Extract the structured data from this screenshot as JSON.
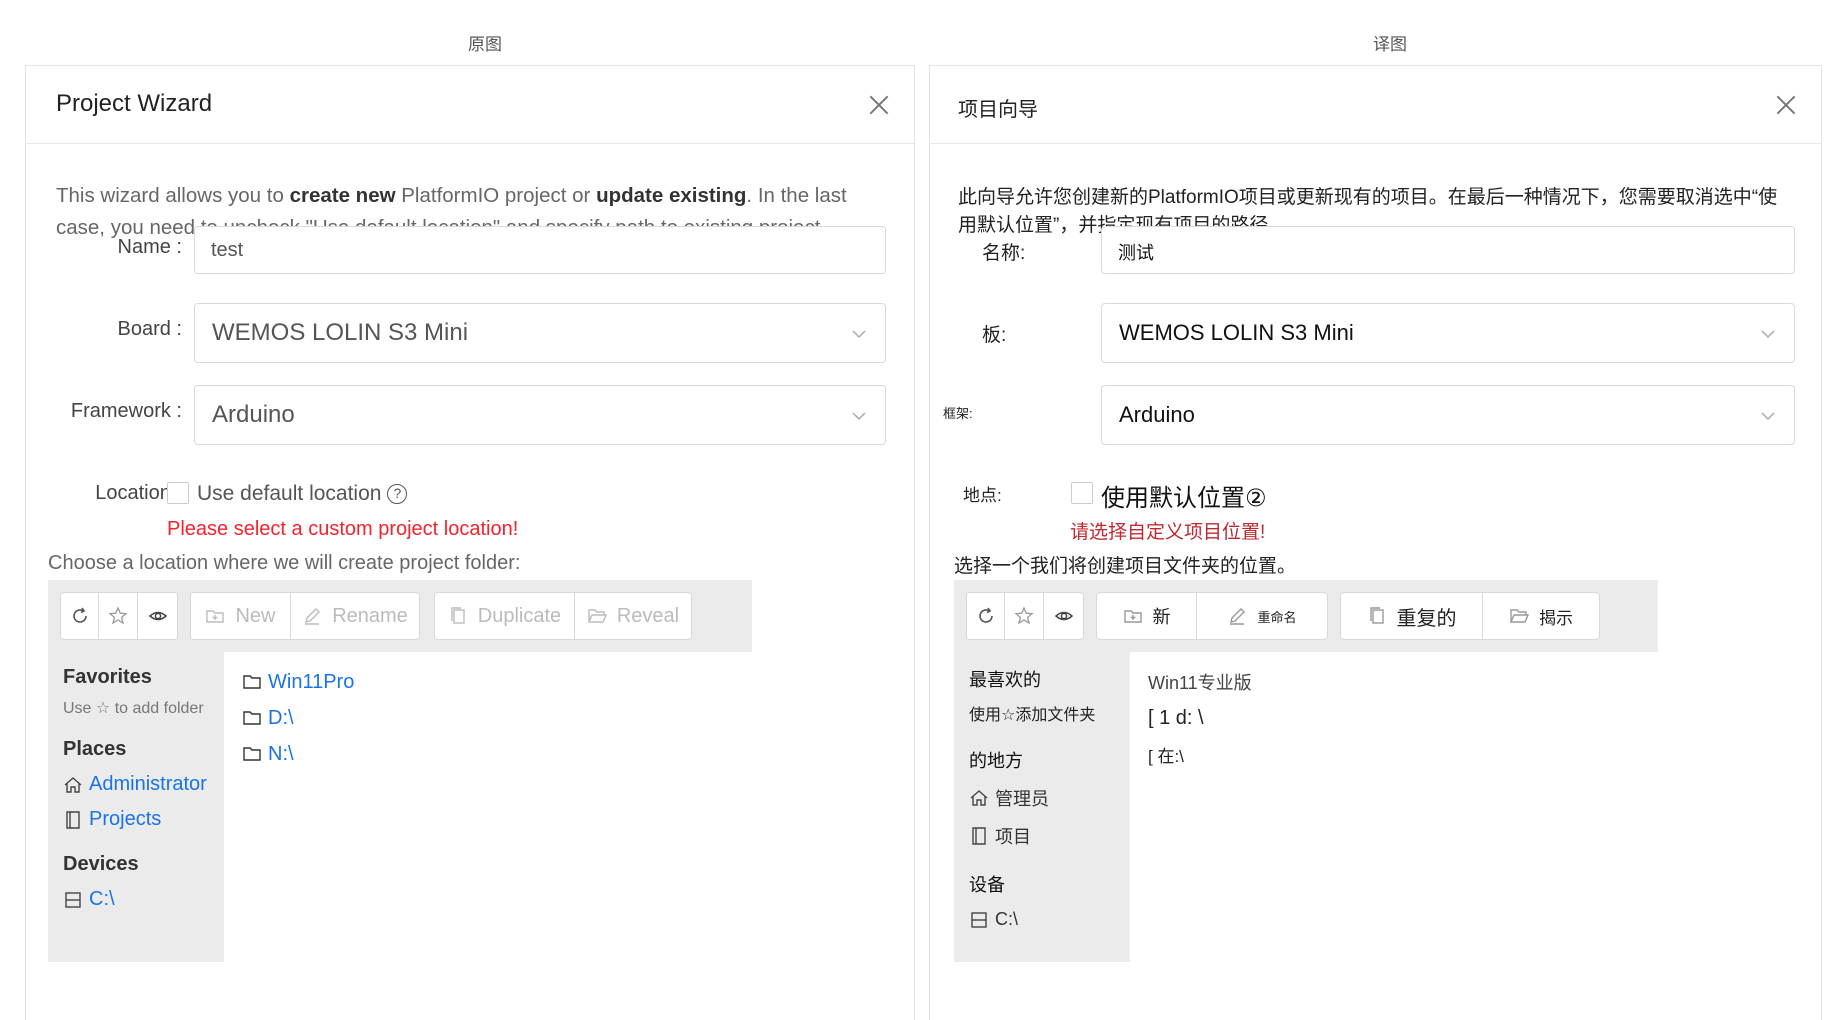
{
  "captions": {
    "left": "原图",
    "right": "译图"
  },
  "left": {
    "title": "Project Wizard",
    "intro": {
      "p1": "This wizard allows you to ",
      "b1": "create new",
      "p2": " PlatformIO project or ",
      "b2": "update existing",
      "p3": ". In the last case, you need to uncheck \"Use default location\" and specify path to existing project."
    },
    "name": {
      "label": "Name",
      "value": "test"
    },
    "board": {
      "label": "Board",
      "value": "WEMOS LOLIN S3 Mini"
    },
    "framework": {
      "label": "Framework",
      "value": "Arduino"
    },
    "location": {
      "label": "Location",
      "checkbox_label": "Use default location",
      "help": "?",
      "checked": false
    },
    "error": "Please select a custom project location!",
    "choose": "Choose a location where we will create project folder:",
    "toolbar": {
      "new": "New",
      "rename": "Rename",
      "duplicate": "Duplicate",
      "reveal": "Reveal"
    },
    "sidebar": {
      "favorites": "Favorites",
      "favorites_hint_pre": "Use",
      "favorites_hint_post": "to add folder",
      "places": "Places",
      "place_items": [
        "Administrator",
        "Projects"
      ],
      "devices": "Devices",
      "device_items": [
        "C:\\"
      ]
    },
    "files": [
      "Win11Pro",
      "D:\\",
      "N:\\"
    ],
    "colors": {
      "link": "#1a73e8",
      "error": "#f5222d",
      "toolbar_bg": "#ebebeb"
    }
  },
  "right": {
    "title": "项目向导",
    "intro": "此向导允许您创建新的PlatformIO项目或更新现有的项目。在最后一种情况下，您需要取消选中“使用默认位置”，并指定现有项目的路径。",
    "name": {
      "label": "名称:",
      "value": "测试"
    },
    "board": {
      "label": "板:",
      "value": "WEMOS LOLIN S3 Mini"
    },
    "framework": {
      "label": "框架:",
      "value": "Arduino"
    },
    "location": {
      "label": "地点:",
      "checkbox_label": "使用默认位置②",
      "checked": false
    },
    "error": "请选择自定义项目位置!",
    "choose": "选择一个我们将创建项目文件夹的位置。",
    "toolbar": {
      "new": "新",
      "rename": "重命名",
      "duplicate": "重复的",
      "reveal": "揭示"
    },
    "sidebar": {
      "favorites": "最喜欢的",
      "favorites_hint": "使用☆添加文件夹",
      "places": "的地方",
      "place_items": [
        "管理员",
        "项目"
      ],
      "devices": "设备",
      "device_items": [
        "C:\\"
      ]
    },
    "files": [
      "Win11专业版",
      "[ 1 d: \\",
      "[ 在:\\"
    ]
  }
}
